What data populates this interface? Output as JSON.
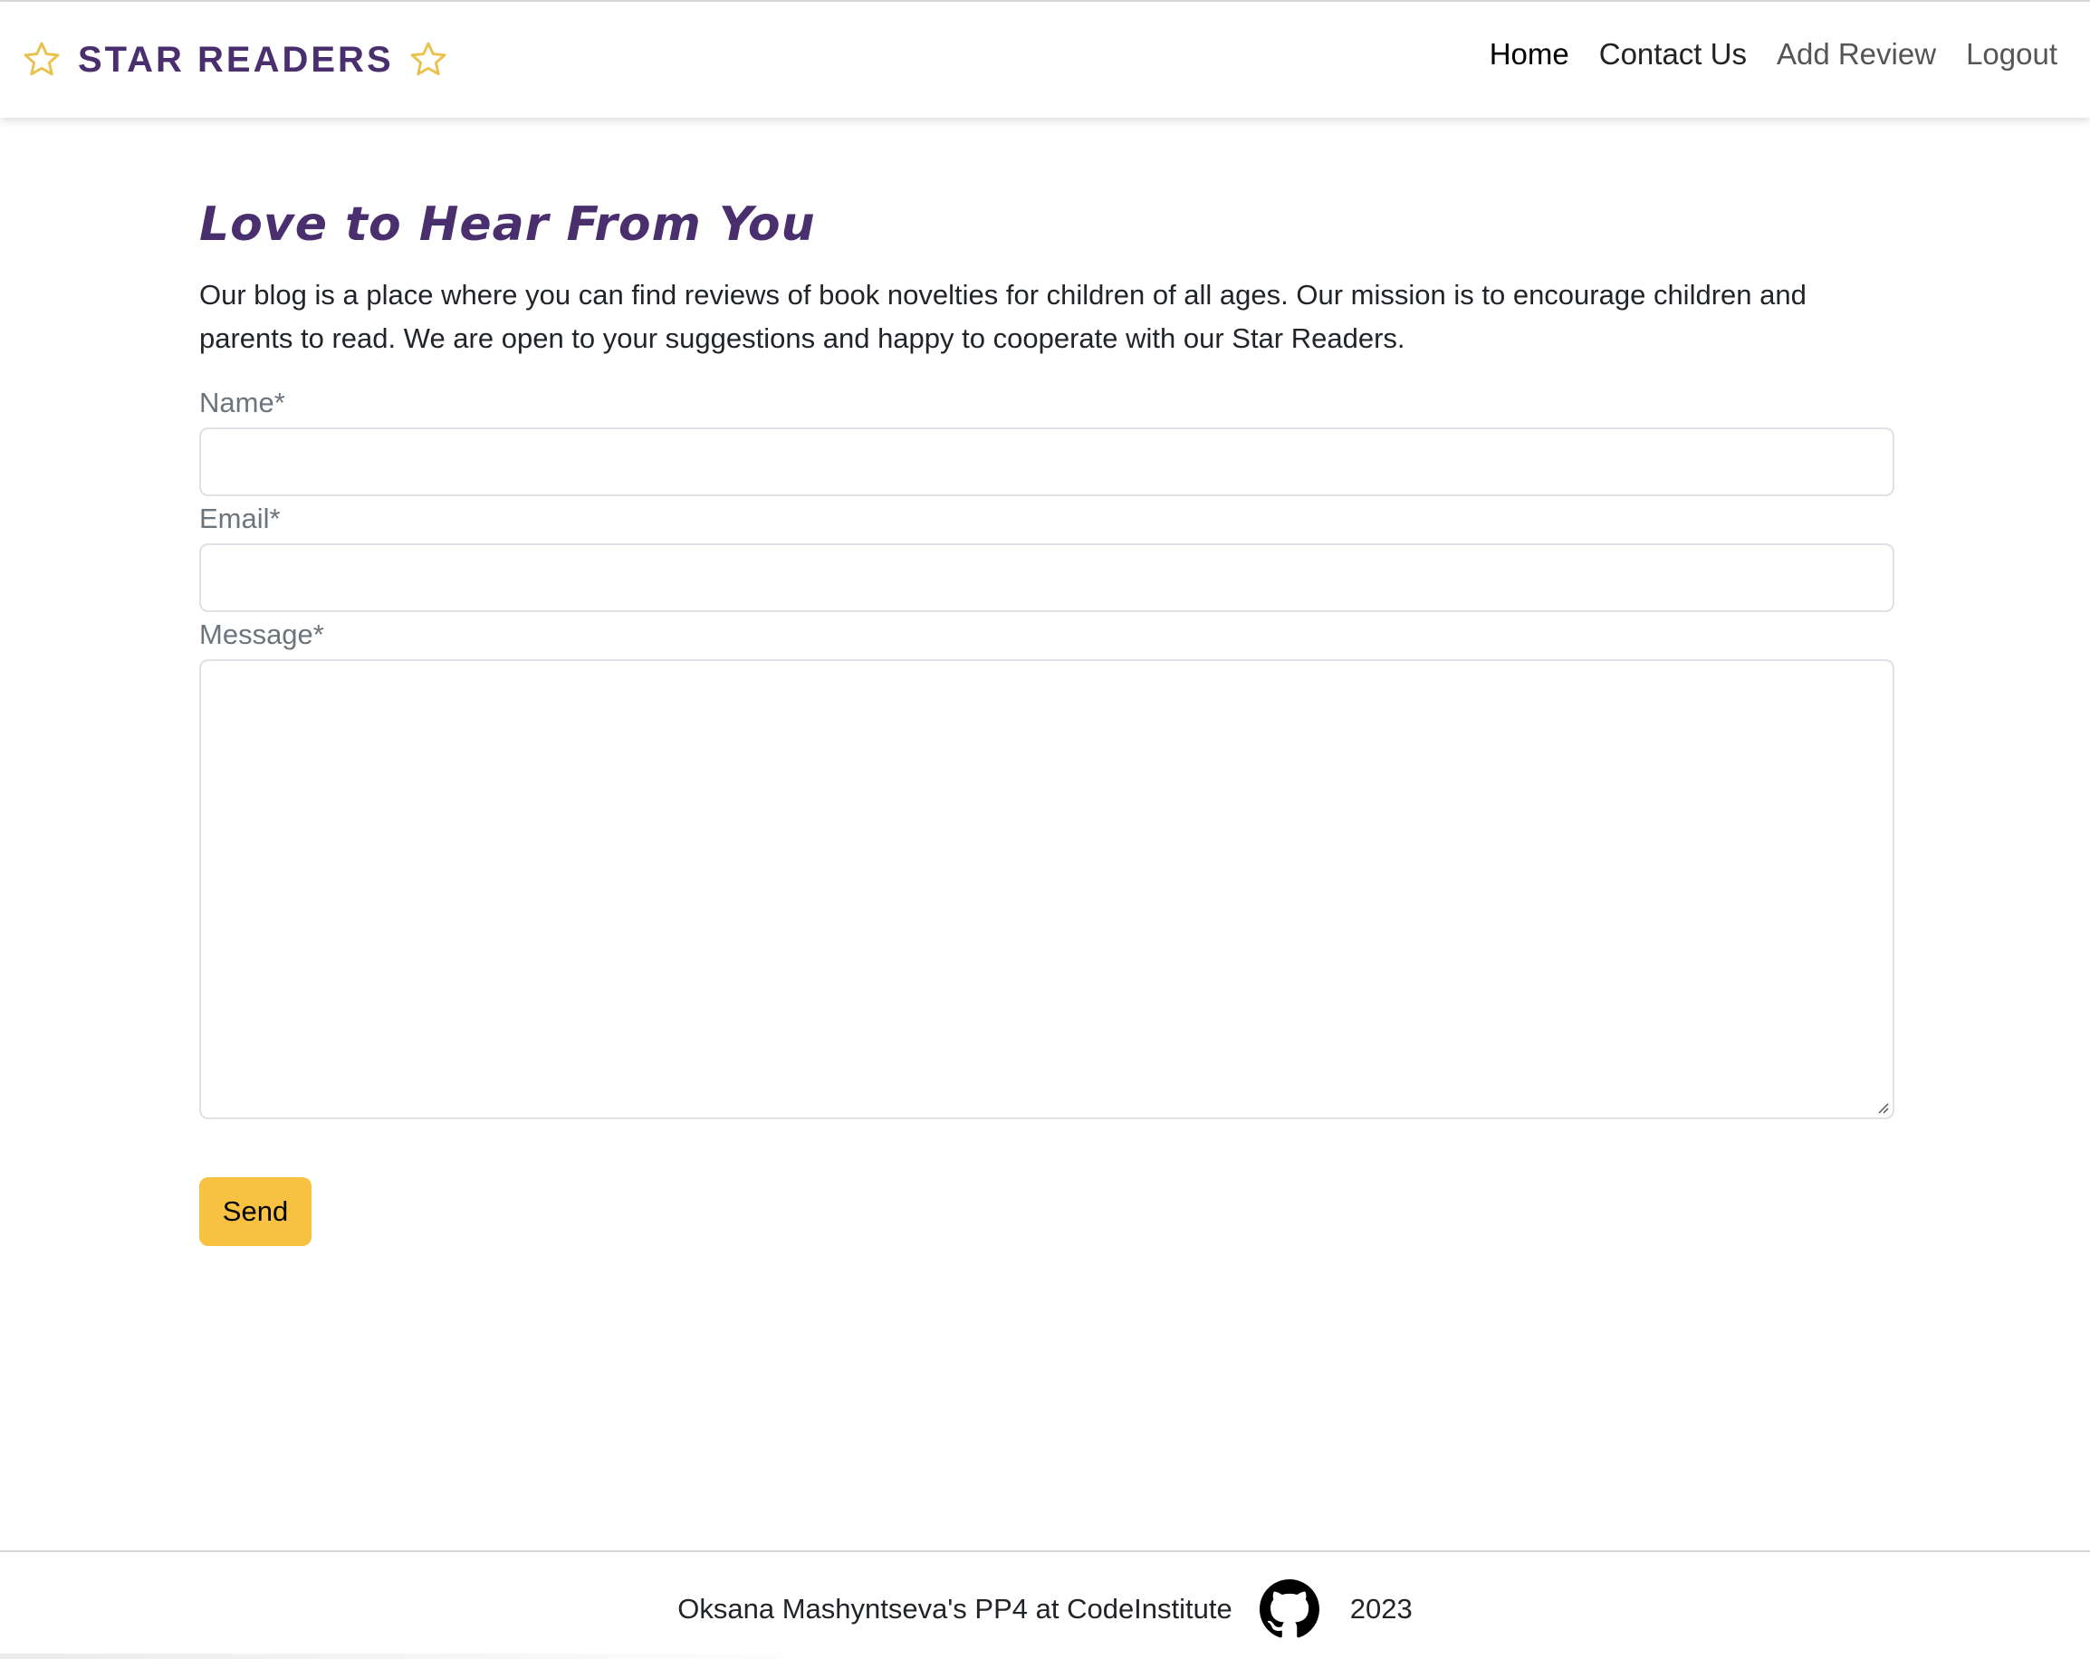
{
  "colors": {
    "brand": "#4a2f6e",
    "star": "#e9c24e",
    "accent_button": "#f7c242",
    "border": "#dee2e6",
    "label": "#6c757d"
  },
  "header": {
    "brand_text": "STAR READERS",
    "brand_icons": [
      "star-outline-icon",
      "star-outline-icon"
    ],
    "nav": [
      {
        "label": "Home"
      },
      {
        "label": "Contact Us"
      },
      {
        "label": "Add Review"
      },
      {
        "label": "Logout"
      }
    ]
  },
  "main": {
    "title": "Love to Hear From You",
    "intro": "Our blog is a place where you can find reviews of book novelties for children of all ages. Our mission is to encourage children and parents to read. We are open to your suggestions and happy to cooperate with our Star Readers.",
    "form": {
      "name_label": "Name*",
      "name_value": "",
      "email_label": "Email*",
      "email_value": "",
      "message_label": "Message*",
      "message_value": "",
      "send_label": "Send"
    }
  },
  "footer": {
    "credit": "Oksana Mashyntseva's PP4 at CodeInstitute",
    "icon": "github-icon",
    "year": "2023"
  }
}
